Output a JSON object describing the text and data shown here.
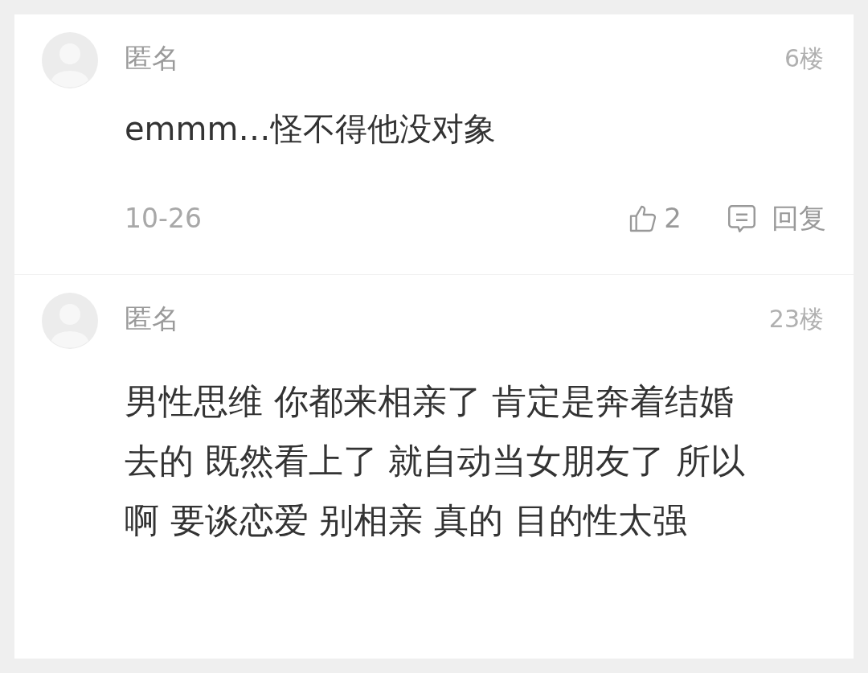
{
  "comments": [
    {
      "author": "匿名",
      "floor": "6楼",
      "text": "emmm…怪不得他没对象",
      "date": "10-26",
      "likes": "2",
      "reply": "回复"
    },
    {
      "author": "匿名",
      "floor": "23楼",
      "text": "男性思维 你都来相亲了 肯定是奔着结婚去的 既然看上了 就自动当女朋友了 所以啊 要谈恋爱 别相亲 真的 目的性太强"
    }
  ]
}
